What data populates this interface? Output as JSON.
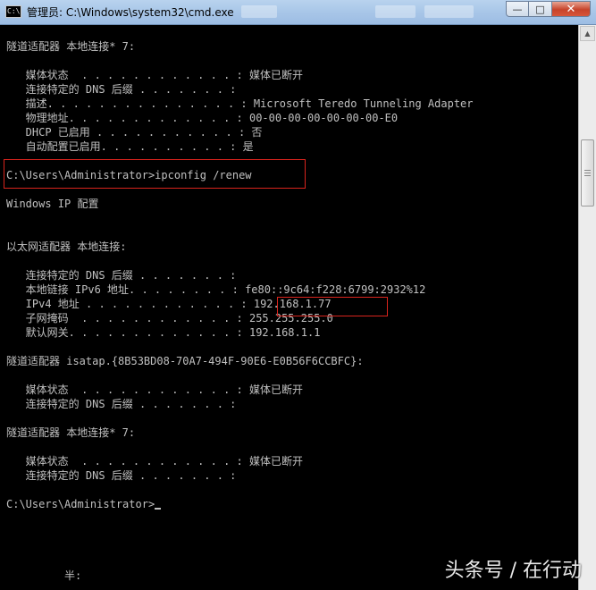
{
  "window": {
    "title": "管理员: C:\\Windows\\system32\\cmd.exe",
    "icon_text": "C:\\",
    "icon": "cmd-icon",
    "controls": {
      "minimize": "—",
      "maximize": "□",
      "close": "✕"
    }
  },
  "console": {
    "lines": [
      "隧道适配器 本地连接* 7:",
      "",
      "   媒体状态  . . . . . . . . . . . . : 媒体已断开",
      "   连接特定的 DNS 后缀 . . . . . . . :",
      "   描述. . . . . . . . . . . . . . . : Microsoft Teredo Tunneling Adapter",
      "   物理地址. . . . . . . . . . . . . : 00-00-00-00-00-00-00-E0",
      "   DHCP 已启用 . . . . . . . . . . . : 否",
      "   自动配置已启用. . . . . . . . . . : 是",
      "",
      "C:\\Users\\Administrator>ipconfig /renew",
      "",
      "Windows IP 配置",
      "",
      "",
      "以太网适配器 本地连接:",
      "",
      "   连接特定的 DNS 后缀 . . . . . . . :",
      "   本地链接 IPv6 地址. . . . . . . . : fe80::9c64:f228:6799:2932%12",
      "   IPv4 地址 . . . . . . . . . . . . : 192.168.1.77",
      "   子网掩码  . . . . . . . . . . . . : 255.255.255.0",
      "   默认网关. . . . . . . . . . . . . : 192.168.1.1",
      "",
      "隧道适配器 isatap.{8B53BD08-70A7-494F-90E6-E0B56F6CCBFC}:",
      "",
      "   媒体状态  . . . . . . . . . . . . : 媒体已断开",
      "   连接特定的 DNS 后缀 . . . . . . . :",
      "",
      "隧道适配器 本地连接* 7:",
      "",
      "   媒体状态  . . . . . . . . . . . . : 媒体已断开",
      "   连接特定的 DNS 后缀 . . . . . . . :",
      "",
      "C:\\Users\\Administrator>",
      "",
      "",
      "",
      "",
      "         半:"
    ],
    "prompt_cursor_line": 32,
    "text_color": "#c0c0c0",
    "background": "#000000"
  },
  "highlights": {
    "color": "#d9241d",
    "command": "ipconfig /renew",
    "ipv4": "192.168.1.77"
  },
  "watermark": "头条号 / 在行动"
}
